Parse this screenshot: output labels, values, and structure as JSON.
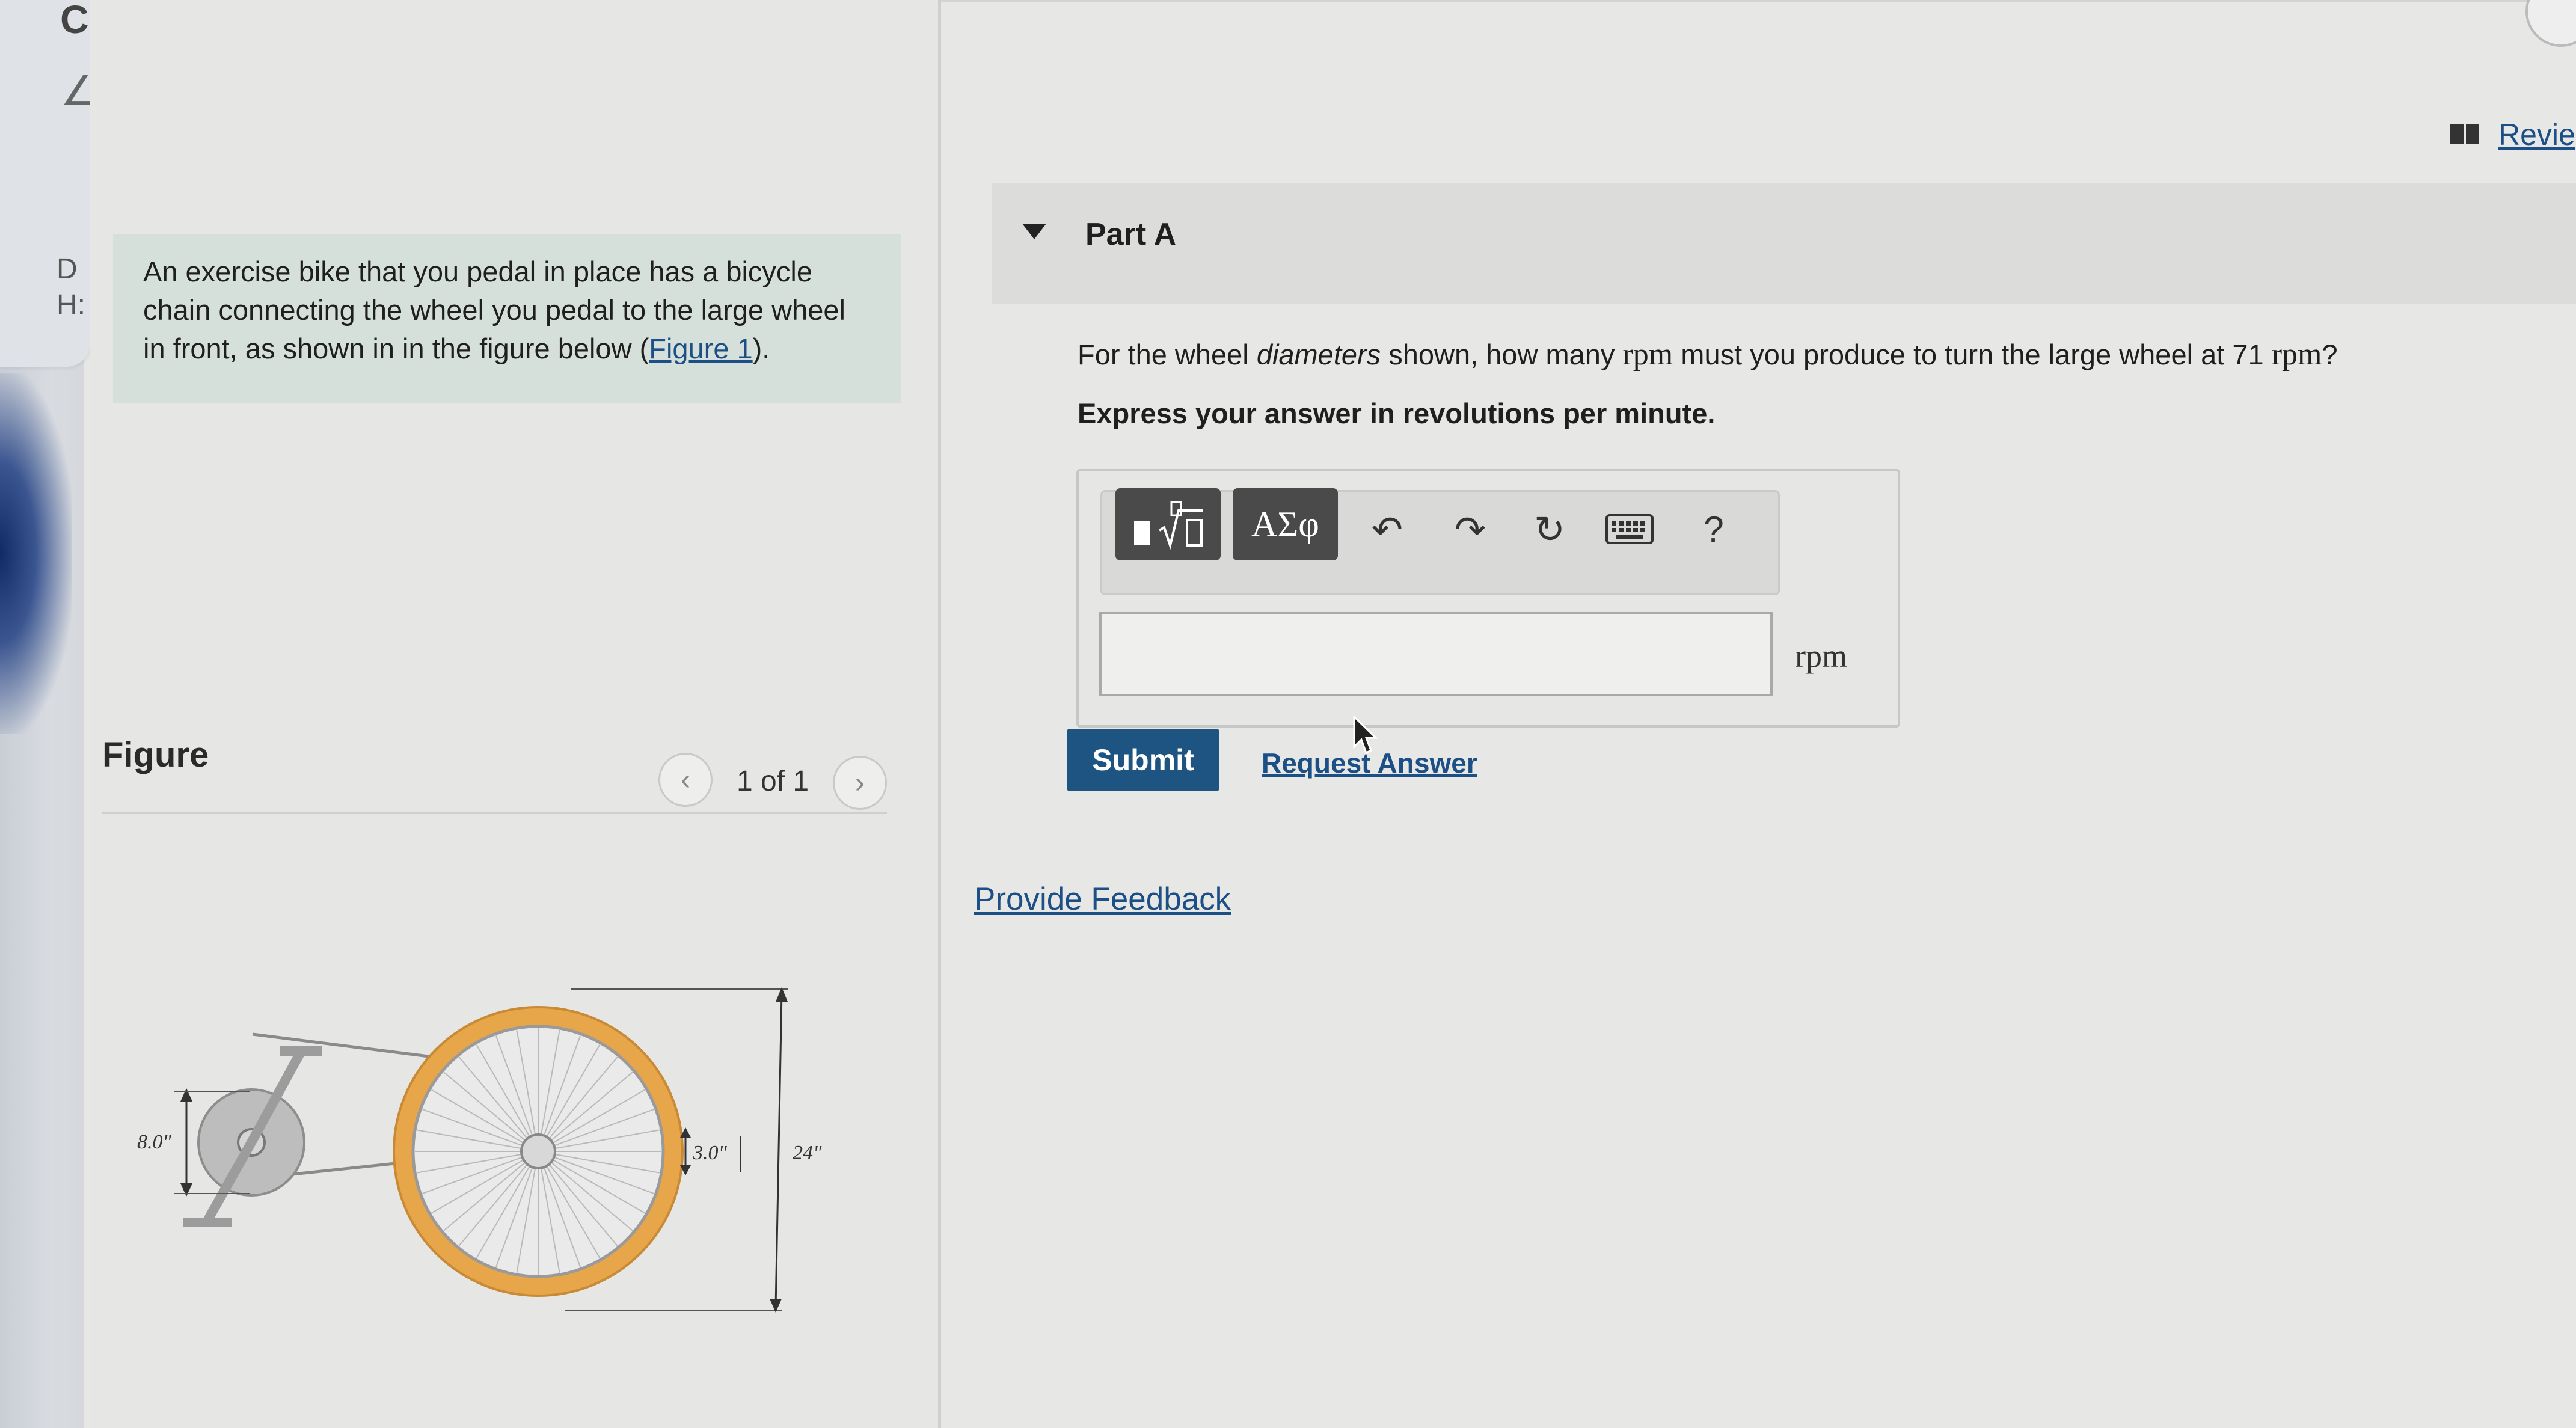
{
  "sidebar_edge": {
    "letter_top": "C",
    "letter_d": "D",
    "letter_h": "H:"
  },
  "intro": {
    "text_before_link": "An exercise bike that you pedal in place has a bicycle chain connecting the wheel you pedal to the large wheel in front, as shown in in the figure below (",
    "link": "Figure 1",
    "text_after_link": ")."
  },
  "figure": {
    "title": "Figure",
    "counter": "1 of 1",
    "labels": {
      "small_wheel": "8.0\"",
      "hub": "3.0\"",
      "large_wheel": "24\""
    }
  },
  "header": {
    "review_label": "Revie"
  },
  "part_a": {
    "title": "Part A",
    "question": {
      "t1": "For the wheel ",
      "italic": "diameters",
      "t2": " shown, how many ",
      "unit1": "rpm",
      "t3": " must you produce to turn the large wheel at 71 ",
      "unit2": "rpm",
      "t4": "?"
    },
    "instruction": "Express your answer in revolutions per minute.",
    "toolbar": {
      "greek_label": "ΑΣφ",
      "help_label": "?"
    },
    "answer": {
      "value": "",
      "unit": "rpm"
    },
    "submit_label": "Submit",
    "request_label": "Request Answer"
  },
  "feedback_label": "Provide Feedback",
  "colors": {
    "link": "#1b4f86",
    "submit_bg": "#1e5482",
    "intro_bg": "#d6e0da",
    "wheel_rim": "#e7a64a"
  }
}
